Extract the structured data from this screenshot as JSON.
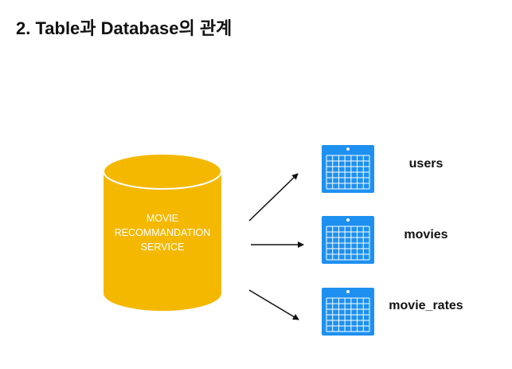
{
  "title": "2. Table과 Database의 관계",
  "database": {
    "label_lines": [
      "MOVIE",
      "RECOMMANDATION",
      "SERVICE"
    ],
    "color": "#F5B800"
  },
  "tables": [
    {
      "name": "users"
    },
    {
      "name": "movies"
    },
    {
      "name": "movie_rates"
    }
  ],
  "colors": {
    "table_icon": "#1E90F0",
    "arrow": "#111111"
  }
}
